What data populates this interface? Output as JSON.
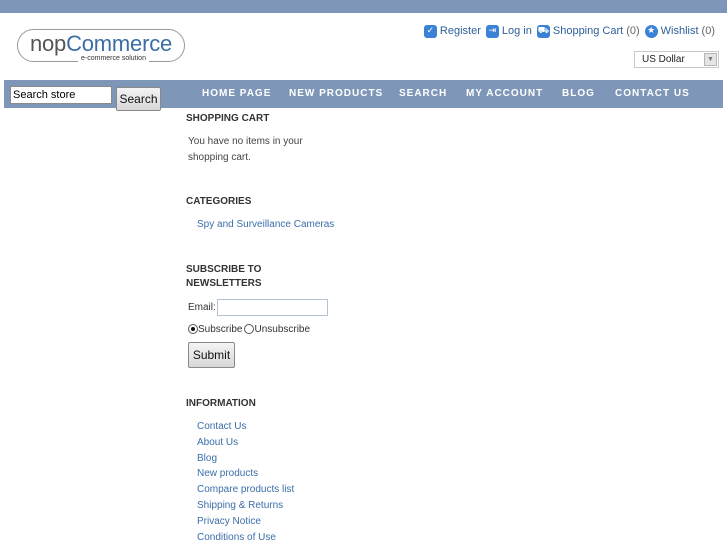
{
  "logo": {
    "name_part1": "nop",
    "name_part2": "Commerce",
    "tagline": "e-commerce solution"
  },
  "header": {
    "links": [
      {
        "icon": "check-icon",
        "label": "Register",
        "count": ""
      },
      {
        "icon": "login-icon",
        "label": "Log in",
        "count": ""
      },
      {
        "icon": "cart-icon",
        "label": "Shopping Cart",
        "count": "(0)"
      },
      {
        "icon": "star-icon",
        "label": "Wishlist",
        "count": "(0)"
      }
    ],
    "currency": "US Dollar"
  },
  "search": {
    "value": "Search store",
    "button_label": "Search"
  },
  "nav": [
    "HOME PAGE",
    "NEW PRODUCTS",
    "SEARCH",
    "MY ACCOUNT",
    "BLOG",
    "CONTACT US"
  ],
  "cart_block": {
    "title": "SHOPPING CART",
    "line1": "You have no items in your",
    "line2": "shopping cart."
  },
  "categories": {
    "title": "CATEGORIES",
    "items": [
      "Spy and Surveillance Cameras"
    ]
  },
  "newsletter": {
    "title_line1": "SUBSCRIBE TO",
    "title_line2": "NEWSLETTERS",
    "email_label": "Email:",
    "email_value": "",
    "subscribe_label": "Subscribe",
    "unsubscribe_label": "Unsubscribe",
    "submit_label": "Submit"
  },
  "information": {
    "title": "INFORMATION",
    "items": [
      "Contact Us",
      "About Us",
      "Blog",
      "New products",
      "Compare products list",
      "Shipping & Returns",
      "Privacy Notice",
      "Conditions of Use"
    ]
  },
  "colors": {
    "bar": "#7e97b8",
    "link": "#3a6ea8",
    "icon": "#3b82d6"
  }
}
